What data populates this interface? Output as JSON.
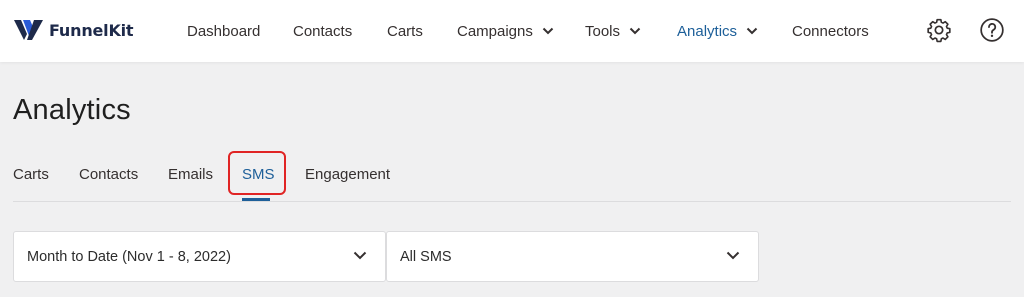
{
  "brand": {
    "name": "FunnelKit",
    "accent": "#1d5f99",
    "logo_blue": "#2a5bd7",
    "logo_dark": "#1e2a4a"
  },
  "nav": {
    "items": [
      {
        "label": "Dashboard",
        "has_dropdown": false,
        "active": false
      },
      {
        "label": "Contacts",
        "has_dropdown": false,
        "active": false
      },
      {
        "label": "Carts",
        "has_dropdown": false,
        "active": false
      },
      {
        "label": "Campaigns",
        "has_dropdown": true,
        "active": false
      },
      {
        "label": "Tools",
        "has_dropdown": true,
        "active": false
      },
      {
        "label": "Analytics",
        "has_dropdown": true,
        "active": true
      },
      {
        "label": "Connectors",
        "has_dropdown": false,
        "active": false
      }
    ],
    "icons": [
      "gear-icon",
      "help-icon"
    ]
  },
  "page": {
    "title": "Analytics"
  },
  "tabs": {
    "items": [
      {
        "label": "Carts",
        "active": false
      },
      {
        "label": "Contacts",
        "active": false
      },
      {
        "label": "Emails",
        "active": false
      },
      {
        "label": "SMS",
        "active": true,
        "highlighted": true
      },
      {
        "label": "Engagement",
        "active": false
      }
    ],
    "highlight_color": "#e02424"
  },
  "filters": {
    "date_range": {
      "value": "Month to Date (Nov 1 - 8, 2022)"
    },
    "sms_select": {
      "value": "All SMS"
    }
  }
}
